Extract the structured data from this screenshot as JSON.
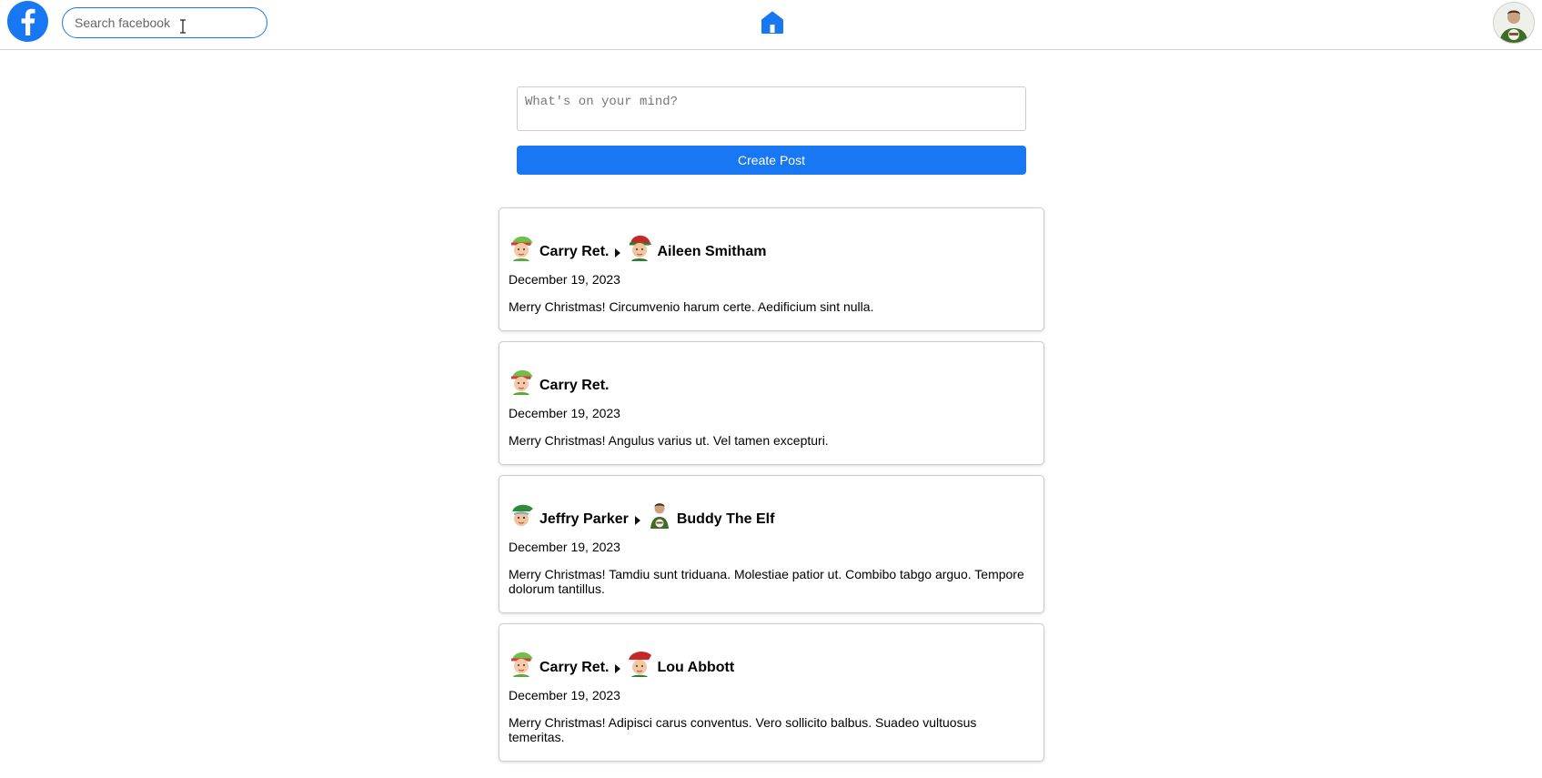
{
  "header": {
    "logo_icon": "facebook-logo-icon",
    "search": {
      "placeholder": "Search facebook",
      "value": ""
    },
    "home_icon": "home-icon",
    "profile_avatar_icon": "buddy-the-elf-avatar-icon"
  },
  "composer": {
    "placeholder": "What's on your mind?",
    "value": "",
    "submit_label": "Create Post"
  },
  "posts": [
    {
      "author": "Carry Ret.",
      "author_icon": "elf-avatar-icon",
      "recipient": "Aileen Smitham",
      "recipient_icon": "elf-red-hat-avatar-icon",
      "date": "December 19, 2023",
      "body": "Merry Christmas! Circumvenio harum certe. Aedificium sint nulla."
    },
    {
      "author": "Carry Ret.",
      "author_icon": "elf-avatar-icon",
      "recipient": "",
      "date": "December 19, 2023",
      "body": "Merry Christmas! Angulus varius ut. Vel tamen excepturi."
    },
    {
      "author": "Jeffry Parker",
      "author_icon": "elf-green-hat-avatar-icon",
      "recipient": "Buddy The Elf",
      "recipient_icon": "buddy-the-elf-avatar-icon",
      "date": "December 19, 2023",
      "body": "Merry Christmas! Tamdiu sunt triduana. Molestiae patior ut. Combibo tabgo arguo. Tempore dolorum tantillus."
    },
    {
      "author": "Carry Ret.",
      "author_icon": "elf-avatar-icon",
      "recipient": "Lou Abbott",
      "recipient_icon": "elf-red-hat-avatar-icon",
      "date": "December 19, 2023",
      "body": "Merry Christmas! Adipisci carus conventus. Vero sollicito balbus. Suadeo vultuosus temeritas."
    }
  ],
  "colors": {
    "brand": "#1877f2",
    "border": "#cccccc"
  }
}
